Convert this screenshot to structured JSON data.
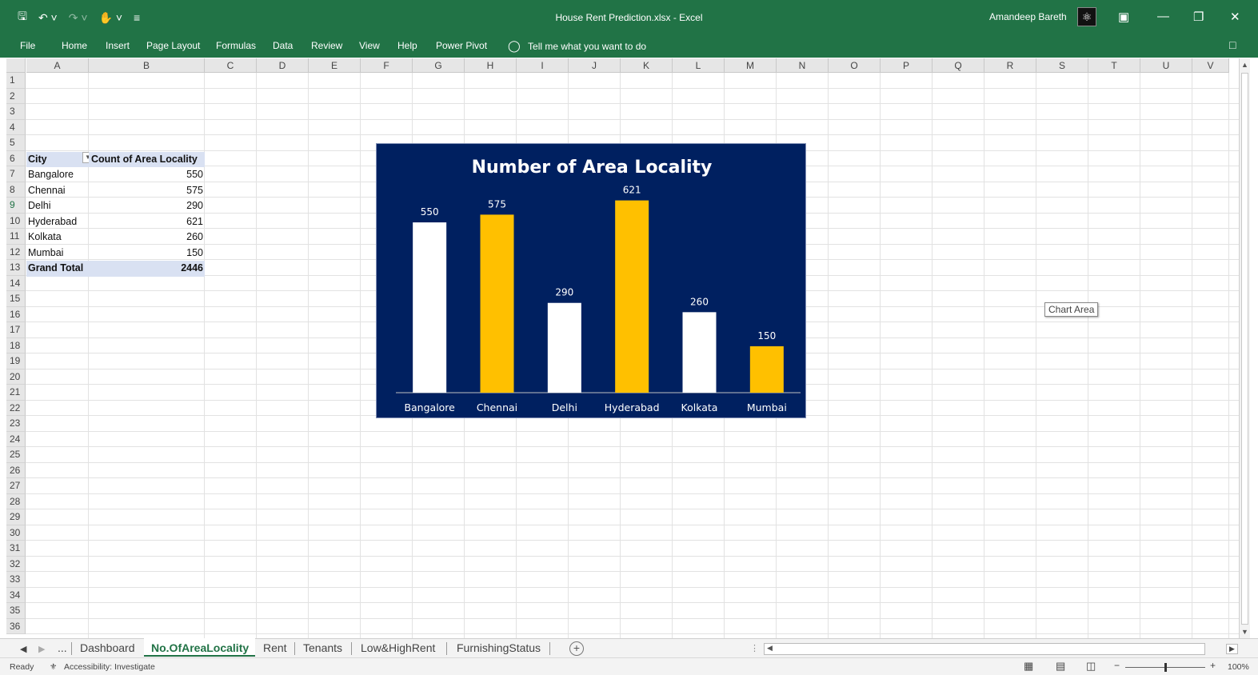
{
  "titlebar": {
    "document_title": "House Rent Prediction.xlsx  -  Excel",
    "user_name": "Amandeep Bareth",
    "qat_icons": [
      "save-icon",
      "undo-icon",
      "redo-icon",
      "touch-mode-icon",
      "customize-qat-icon"
    ]
  },
  "ribbon": {
    "tabs": [
      "File",
      "Home",
      "Insert",
      "Page Layout",
      "Formulas",
      "Data",
      "Review",
      "View",
      "Help",
      "Power Pivot"
    ],
    "tell_me": "Tell me what you want to do"
  },
  "grid": {
    "columns": [
      "A",
      "B",
      "C",
      "D",
      "E",
      "F",
      "G",
      "H",
      "I",
      "J",
      "K",
      "L",
      "M",
      "N",
      "O",
      "P",
      "Q",
      "R",
      "S",
      "T",
      "U",
      "V"
    ],
    "rows": [
      "1",
      "2",
      "3",
      "4",
      "5",
      "6",
      "7",
      "8",
      "9",
      "10",
      "11",
      "12",
      "13",
      "14",
      "15",
      "16",
      "17",
      "18",
      "19",
      "20",
      "21",
      "22",
      "23",
      "24",
      "25",
      "26",
      "27",
      "28",
      "29",
      "30",
      "31",
      "32",
      "33",
      "34",
      "35",
      "36"
    ],
    "selected_row": "9"
  },
  "pivot": {
    "header_city": "City",
    "header_count": "Count of Area Locality",
    "rows": [
      {
        "city": "Bangalore",
        "count": "550"
      },
      {
        "city": "Chennai",
        "count": "575"
      },
      {
        "city": "Delhi",
        "count": "290"
      },
      {
        "city": "Hyderabad",
        "count": "621"
      },
      {
        "city": "Kolkata",
        "count": "260"
      },
      {
        "city": "Mumbai",
        "count": "150"
      }
    ],
    "total_label": "Grand Total",
    "total_value": "2446"
  },
  "chart_data": {
    "type": "bar",
    "title": "Number of Area Locality",
    "categories": [
      "Bangalore",
      "Chennai",
      "Delhi",
      "Hyderabad",
      "Kolkata",
      "Mumbai"
    ],
    "values": [
      550,
      575,
      290,
      621,
      260,
      150
    ],
    "bar_colors": [
      "#ffffff",
      "#ffc000",
      "#ffffff",
      "#ffc000",
      "#ffffff",
      "#ffc000"
    ],
    "background": "#002060",
    "data_labels": true,
    "grid": false,
    "ylim": [
      0,
      700
    ]
  },
  "tooltip": "Chart Area",
  "sheets": {
    "tabs": [
      "Dashboard",
      "No.OfAreaLocality",
      "Rent",
      "Tenants",
      "Low&HighRent",
      "FurnishingStatus"
    ],
    "active": "No.OfAreaLocality",
    "ellipsis": "..."
  },
  "status": {
    "ready": "Ready",
    "accessibility": "Accessibility: Investigate",
    "zoom": "100%"
  },
  "colors": {
    "excel_green": "#217346",
    "pivot_header": "#d9e1f2",
    "bar_gold": "#ffc000"
  }
}
